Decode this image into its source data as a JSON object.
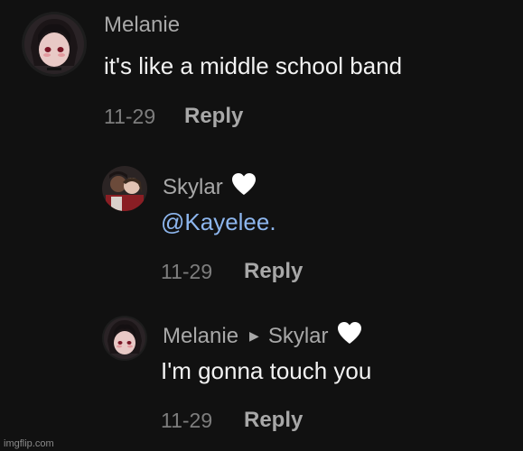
{
  "comments": [
    {
      "username": "Melanie",
      "text": "it's like a middle school band",
      "date": "11-29",
      "reply_label": "Reply"
    },
    {
      "username": "Skylar",
      "text": "@Kayelee.",
      "date": "11-29",
      "reply_label": "Reply",
      "heart_icon": "white-heart-icon"
    },
    {
      "username": "Melanie",
      "reply_to": "Skylar",
      "text": "I'm gonna touch you",
      "date": "11-29",
      "reply_label": "Reply",
      "heart_icon": "white-heart-icon"
    }
  ],
  "watermark": "imgflip.com",
  "colors": {
    "background": "#111111",
    "mention": "#8db6ee",
    "username": "#a8a8a8",
    "date": "#7d7d7d"
  }
}
